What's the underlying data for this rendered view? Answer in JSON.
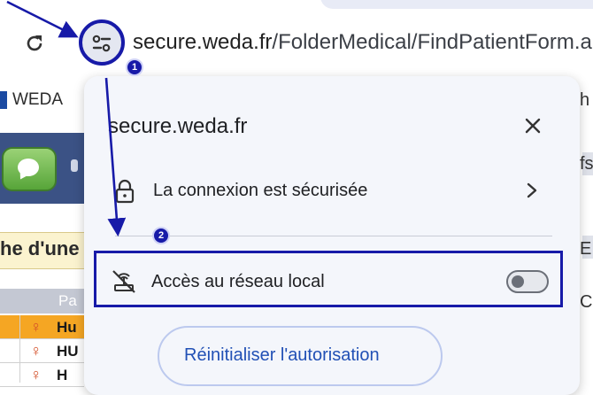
{
  "browser": {
    "url_domain": "secure.weda.fr",
    "url_path": "/FolderMedical/FindPatientForm.a",
    "site_info_icon": "tune-icon",
    "reload_icon": "reload-icon"
  },
  "background_page": {
    "bookmark_label": "WEDA",
    "search_label": "he d'une",
    "table_header": "Pa",
    "rows": [
      {
        "icon": "♀",
        "name": "Hu"
      },
      {
        "icon": "♀",
        "name": "HU"
      },
      {
        "icon": "♀",
        "name": "H"
      }
    ],
    "right_edge": [
      "h",
      "fs",
      "E",
      "C"
    ]
  },
  "popup": {
    "title": "secure.weda.fr",
    "close_icon": "close-icon",
    "connection_label": "La connexion est sécurisée",
    "local_network_label": "Accès au réseau local",
    "local_network_enabled": false,
    "reset_button_label": "Réinitialiser l'autorisation"
  },
  "annotations": {
    "badge_1": "1",
    "badge_2": "2",
    "color": "#171aa8"
  }
}
